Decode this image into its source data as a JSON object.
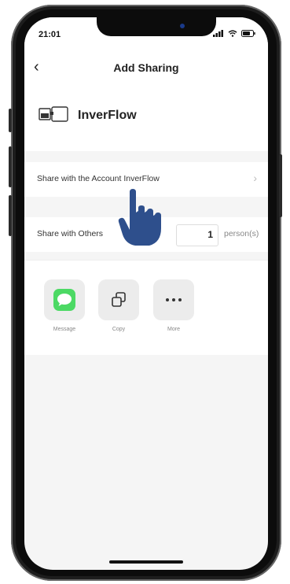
{
  "status_bar": {
    "time": "21:01"
  },
  "nav": {
    "title": "Add Sharing"
  },
  "device": {
    "name": "InverFlow"
  },
  "share_account": {
    "label": "Share with the Account InverFlow"
  },
  "share_others": {
    "label": "Share with Others",
    "quantity": "1",
    "unit": "person(s)"
  },
  "share_options": [
    {
      "label": "Message",
      "icon": "message-icon"
    },
    {
      "label": "Copy",
      "icon": "copy-icon"
    },
    {
      "label": "More",
      "icon": "more-icon"
    }
  ],
  "colors": {
    "message_green": "#4CD964",
    "hand_blue": "#2E4F8C"
  }
}
